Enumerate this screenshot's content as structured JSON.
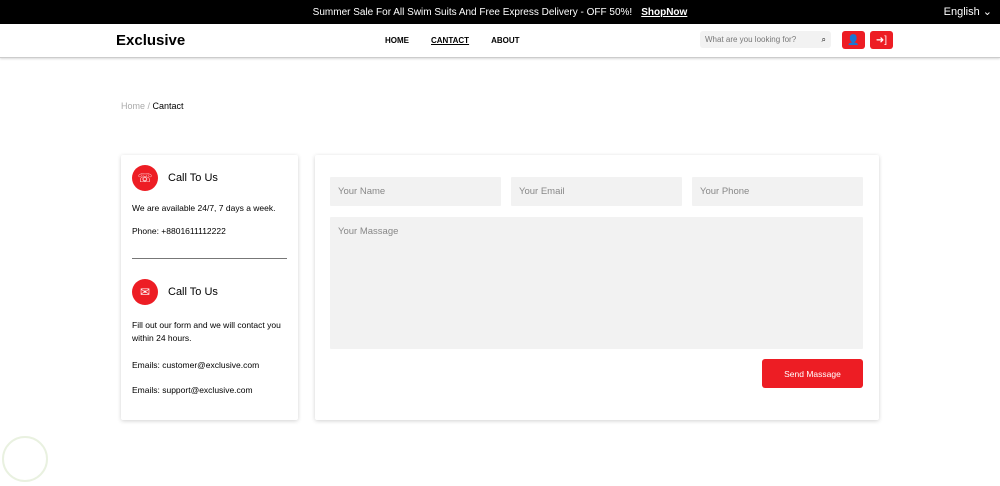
{
  "topbar": {
    "message": "Summer Sale For All Swim Suits And Free Express Delivery - OFF 50%!",
    "shop_link": "ShopNow",
    "language": "English ⌄"
  },
  "header": {
    "logo": "Exclusive",
    "nav": [
      "HOME",
      "CANTACT",
      "ABOUT"
    ],
    "search_placeholder": "What are you looking for?"
  },
  "breadcrumb": {
    "home": "Home",
    "separator": " / ",
    "current": "Cantact"
  },
  "contact": {
    "call": {
      "title": "Call To Us",
      "line1": "We are available 24/7, 7 days a week.",
      "phone": "Phone: +8801611112222"
    },
    "write": {
      "title": "Call To Us",
      "line1": "Fill out our form and we will contact you within 24 hours.",
      "email1": "Emails: customer@exclusive.com",
      "email2": "Emails: support@exclusive.com"
    }
  },
  "form": {
    "name_placeholder": "Your Name",
    "email_placeholder": "Your Email",
    "phone_placeholder": "Your Phone",
    "message_placeholder": "Your Massage",
    "send_label": "Send Massage"
  },
  "colors": {
    "accent": "#ed1d24"
  }
}
